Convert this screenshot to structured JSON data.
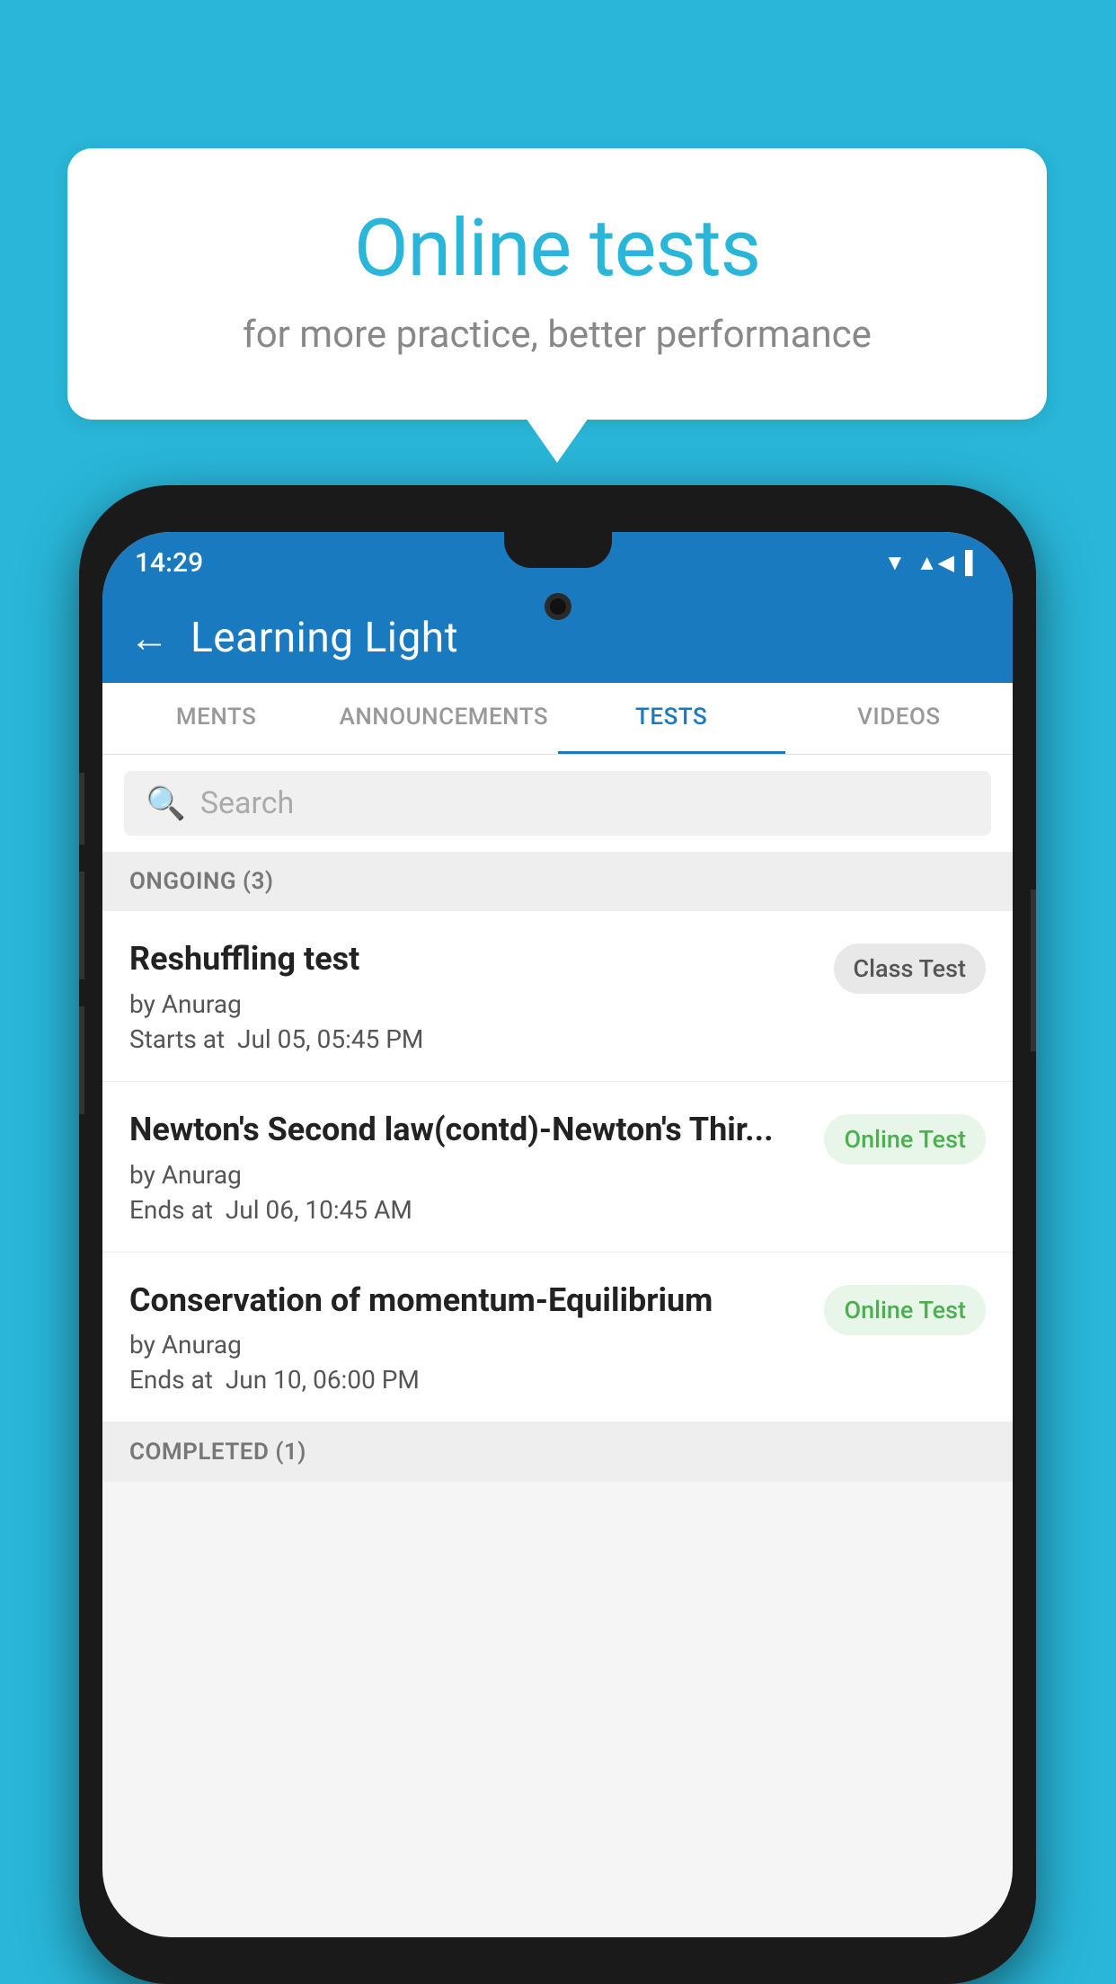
{
  "background_color": "#29b6d8",
  "bubble": {
    "title": "Online tests",
    "subtitle": "for more practice, better performance"
  },
  "phone": {
    "status_bar": {
      "time": "14:29",
      "icons": [
        "▼▲",
        "◀",
        "▌"
      ]
    },
    "header": {
      "back_label": "←",
      "title": "Learning Light"
    },
    "tabs": [
      {
        "label": "MENTS",
        "active": false
      },
      {
        "label": "ANNOUNCEMENTS",
        "active": false
      },
      {
        "label": "TESTS",
        "active": true
      },
      {
        "label": "VIDEOS",
        "active": false
      }
    ],
    "search": {
      "placeholder": "Search"
    },
    "ongoing": {
      "section_label": "ONGOING (3)",
      "items": [
        {
          "name": "Reshuffling test",
          "author": "by Anurag",
          "time_label": "Starts at",
          "time_value": "Jul 05, 05:45 PM",
          "badge": "Class Test",
          "badge_type": "class"
        },
        {
          "name": "Newton's Second law(contd)-Newton's Thir...",
          "author": "by Anurag",
          "time_label": "Ends at",
          "time_value": "Jul 06, 10:45 AM",
          "badge": "Online Test",
          "badge_type": "online"
        },
        {
          "name": "Conservation of momentum-Equilibrium",
          "author": "by Anurag",
          "time_label": "Ends at",
          "time_value": "Jun 10, 06:00 PM",
          "badge": "Online Test",
          "badge_type": "online"
        }
      ]
    },
    "completed": {
      "section_label": "COMPLETED (1)"
    }
  }
}
